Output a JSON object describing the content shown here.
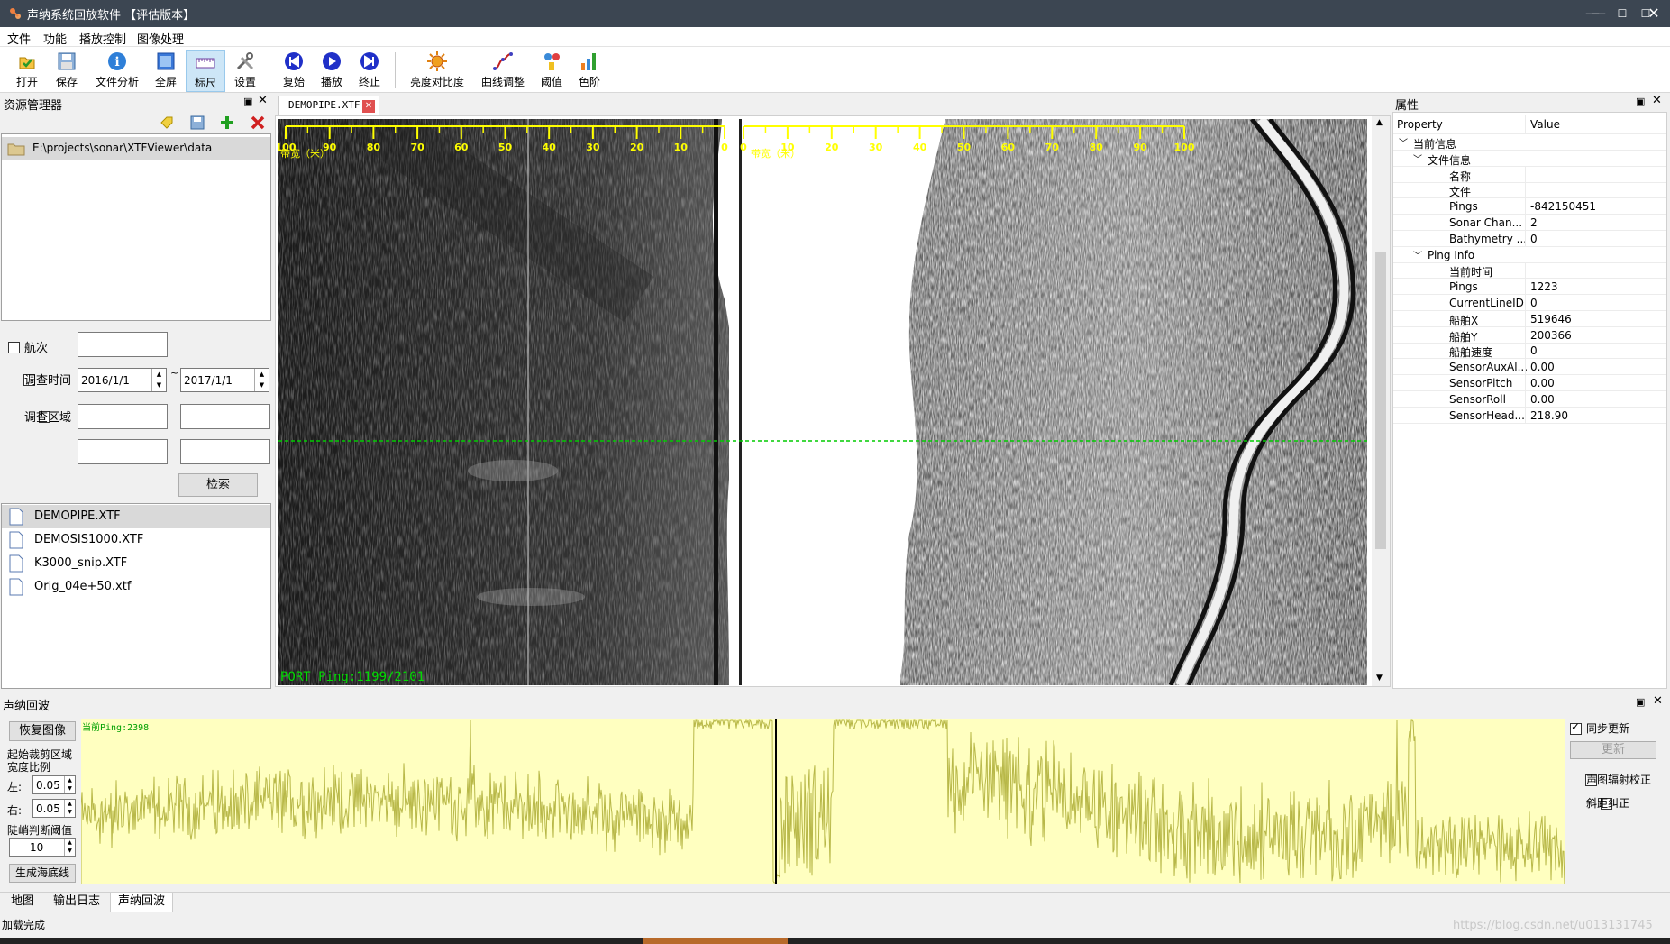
{
  "window": {
    "title": "声纳系统回放软件 【评估版本】",
    "controls": [
      "—",
      "☐",
      "✕"
    ]
  },
  "menu": [
    "文件",
    "功能",
    "播放控制",
    "图像处理"
  ],
  "toolbar": {
    "open": "打开",
    "save": "保存",
    "file_analysis": "文件分析",
    "fullscreen": "全屏",
    "ruler": "标尺",
    "settings": "设置",
    "rewind": "复始",
    "play": "播放",
    "stop": "终止",
    "brightness": "亮度对比度",
    "curve": "曲线调整",
    "threshold": "阈值",
    "color_scale": "色阶"
  },
  "resource_manager": {
    "title": "资源管理器",
    "path": "E:\\projects\\sonar\\XTFViewer\\data",
    "voyage_label": "航次",
    "survey_time_label": "调查时间",
    "date_from": "2016/1/1",
    "date_to": "2017/1/1",
    "tilde": "~",
    "area_label": "调查区域",
    "search_button": "检索",
    "files": [
      "DEMOPIPE.XTF",
      "DEMOSIS1000.XTF",
      "K3000_snip.XTF",
      "Orig_04e+50.xtf"
    ]
  },
  "document_tab": {
    "label": "DEMOPIPE.XTF"
  },
  "sonar_view": {
    "left_ticks": [
      "100",
      "90",
      "80",
      "70",
      "60",
      "50",
      "40",
      "30",
      "20",
      "10",
      "0"
    ],
    "right_ticks": [
      "0",
      "10",
      "20",
      "30",
      "40",
      "50",
      "60",
      "70",
      "80",
      "90",
      "100"
    ],
    "left_axis_label": "带宽（米）",
    "right_axis_label": "带宽（米）",
    "port_ping": "PORT Ping:1199/2101",
    "ruler_color": "#ffff00",
    "cursor_line_color": "#00cc00"
  },
  "properties": {
    "title": "属性",
    "col_property": "Property",
    "col_value": "Value",
    "root_group": "当前信息",
    "file_group": "文件信息",
    "file_rows": [
      {
        "k": "名称",
        "v": ""
      },
      {
        "k": "文件",
        "v": ""
      },
      {
        "k": "Pings",
        "v": "-842150451"
      },
      {
        "k": "Sonar Chan...",
        "v": "2"
      },
      {
        "k": "Bathymetry ...",
        "v": "0"
      }
    ],
    "ping_group": "Ping Info",
    "ping_rows": [
      {
        "k": "当前时间",
        "v": ""
      },
      {
        "k": "Pings",
        "v": "1223"
      },
      {
        "k": "CurrentLineID",
        "v": "0"
      },
      {
        "k": "船舶X",
        "v": "519646"
      },
      {
        "k": "船舶Y",
        "v": "200366"
      },
      {
        "k": "船舶速度",
        "v": "0"
      },
      {
        "k": "SensorAuxAl...",
        "v": "0.00"
      },
      {
        "k": "SensorPitch",
        "v": "0.00"
      },
      {
        "k": "SensorRoll",
        "v": "0.00"
      },
      {
        "k": "SensorHead...",
        "v": "218.90"
      }
    ]
  },
  "echo_panel": {
    "title": "声纳回波",
    "restore_button": "恢复图像",
    "crop_label_1": "起始裁剪区域",
    "crop_label_2": "宽度比例",
    "left_label": "左:",
    "left_value": "0.05",
    "right_label": "右:",
    "right_value": "0.05",
    "threshold_label": "陡峭判断阈值",
    "threshold_value": "10",
    "generate_button": "生成海底线",
    "current_ping": "当前Ping:2398",
    "sync_update": "同步更新",
    "update_button": "更新",
    "radiometric": "声图辐射校正",
    "slant": "斜距纠正",
    "signal_color": "#b8b848",
    "fill_color": "#ffffc0"
  },
  "bottom_tabs": [
    "地图",
    "输出日志",
    "声纳回波"
  ],
  "status": "加载完成",
  "watermark": "https://blog.csdn.net/u013131745"
}
